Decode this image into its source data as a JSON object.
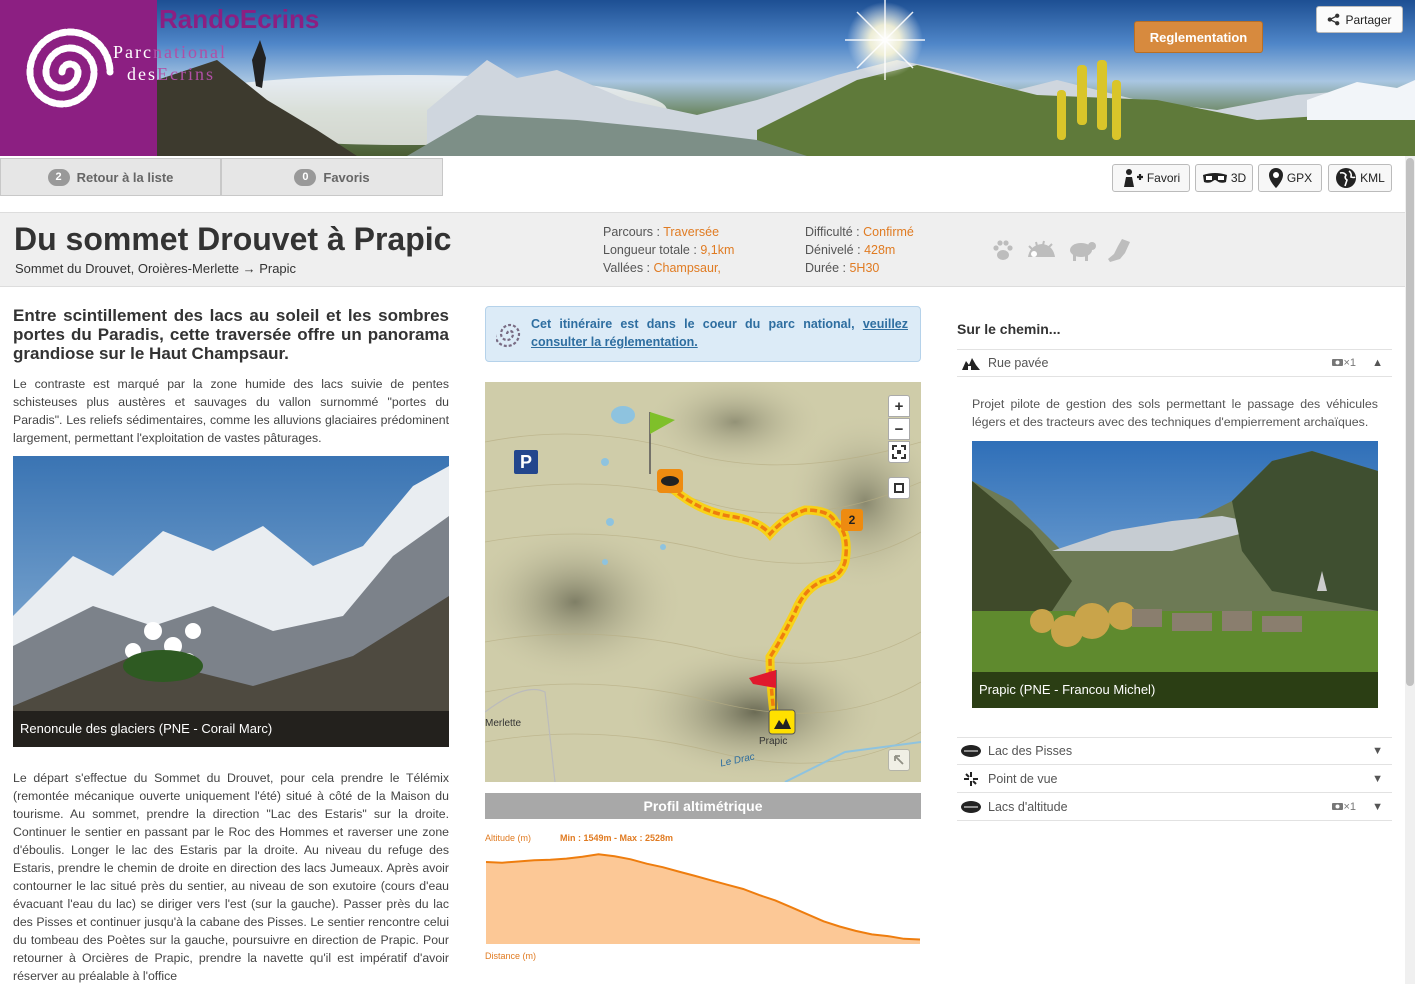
{
  "banner": {
    "brand": "RandoEcrins",
    "park_line1_a": "Parc",
    "park_line1_b": "national",
    "park_line2_a": "des",
    "park_line2_b": "Ecrins",
    "regulation_button": "Reglementation",
    "share_button": "Partager"
  },
  "nav": {
    "back_count": "2",
    "back_label": "Retour à la liste",
    "fav_count": "0",
    "fav_label": "Favoris",
    "tools": {
      "favori": "Favori",
      "three_d": "3D",
      "gpx": "GPX",
      "kml": "KML"
    }
  },
  "trek": {
    "title": "Du sommet Drouvet à Prapic",
    "subtitle": "Sommet du Drouvet, Oroières-Merlette → Prapic",
    "parcours_label": "Parcours :",
    "parcours": "Traversée",
    "longueur_label": "Longueur totale :",
    "longueur": "9,1km",
    "vallees_label": "Vallées :",
    "vallees": "Champsaur,",
    "difficulte_label": "Difficulté :",
    "difficulte": "Confirmé",
    "denivele_label": "Dénivelé :",
    "denivele": "428m",
    "duree_label": "Durée :",
    "duree": "5H30",
    "theme_icons": [
      "paw-icon",
      "hedgehog-icon",
      "sheep-icon",
      "boot-icon"
    ]
  },
  "content": {
    "lead": "Entre scintillement des lacs au soleil et les sombres portes du Paradis, cette traversée offre un panorama grandiose sur le Haut Champsaur.",
    "intro": "Le contraste est marqué par la zone humide des lacs suivie de pentes schisteuses plus austères et sauvages du vallon surnommé \"portes du Paradis\". Les reliefs sédimentaires, comme les alluvions glaciaires prédominent largement, permettant l'exploitation de vastes pâturages.",
    "photo1_caption": "Renoncule des glaciers (PNE - Corail Marc)",
    "description": "Le départ s'effectue du Sommet du Drouvet, pour cela prendre le Télémix (remontée mécanique ouverte uniquement l'été) situé à côté de la Maison du tourisme. Au sommet, prendre la direction \"Lac des Estaris\" sur la droite. Continuer le sentier en passant par le Roc des Hommes et raverser une zone d'éboulis. Longer le lac des Estaris par la droite. Au niveau du refuge des Estaris, prendre le chemin de droite en direction des lacs Jumeaux. Après avoir contourner le lac situé près du sentier, au niveau de son exutoire (cours d'eau évacuant l'eau du lac) se diriger vers l'est (sur la gauche). Passer près du lac des Pisses et continuer jusqu'à la cabane des Pisses. Le sentier rencontre celui du tombeau des Poètes sur la gauche, poursuivre en direction de Prapic. Pour retourner à Orcières de Prapic, prendre la navette qu'il est impératif d'avoir réserver au préalable à l'office"
  },
  "notice": {
    "text": "Cet itinéraire est dans le coeur du parc national,",
    "link": "veuillez consulter la réglementation."
  },
  "map": {
    "labels": {
      "merlette": "Merlette",
      "prapic": "Prapic",
      "river": "Le Drac"
    },
    "step_number": "2",
    "zoom_in": "+",
    "zoom_out": "−"
  },
  "profile": {
    "heading": "Profil altimétrique",
    "altitude_label": "Altitude (m)",
    "minmax": "Min : 1549m - Max : 2528m",
    "distance_label": "Distance (m)",
    "elevation_series": [
      2440,
      2432,
      2445,
      2460,
      2465,
      2478,
      2500,
      2528,
      2505,
      2470,
      2420,
      2380,
      2330,
      2280,
      2230,
      2180,
      2130,
      2060,
      2000,
      1920,
      1840,
      1760,
      1700,
      1650,
      1610,
      1590,
      1560,
      1552
    ]
  },
  "sidebar": {
    "heading": "Sur le chemin...",
    "pois": [
      {
        "label": "Rue pavée",
        "icon": "village-icon",
        "photos": "×1",
        "expanded": true
      },
      {
        "label": "Lac des Pisses",
        "icon": "lake-icon",
        "photos": "",
        "expanded": false
      },
      {
        "label": "Point de vue",
        "icon": "viewpoint-icon",
        "photos": "",
        "expanded": false
      },
      {
        "label": "Lacs d'altitude",
        "icon": "lake-icon",
        "photos": "×1",
        "expanded": false
      }
    ],
    "poi_description": "Projet pilote de gestion des sols permettant le passage des véhicules légers et des tracteurs avec des techniques d'empierrement archaïques.",
    "photo2_caption": "Prapic (PNE - Francou Michel)"
  }
}
